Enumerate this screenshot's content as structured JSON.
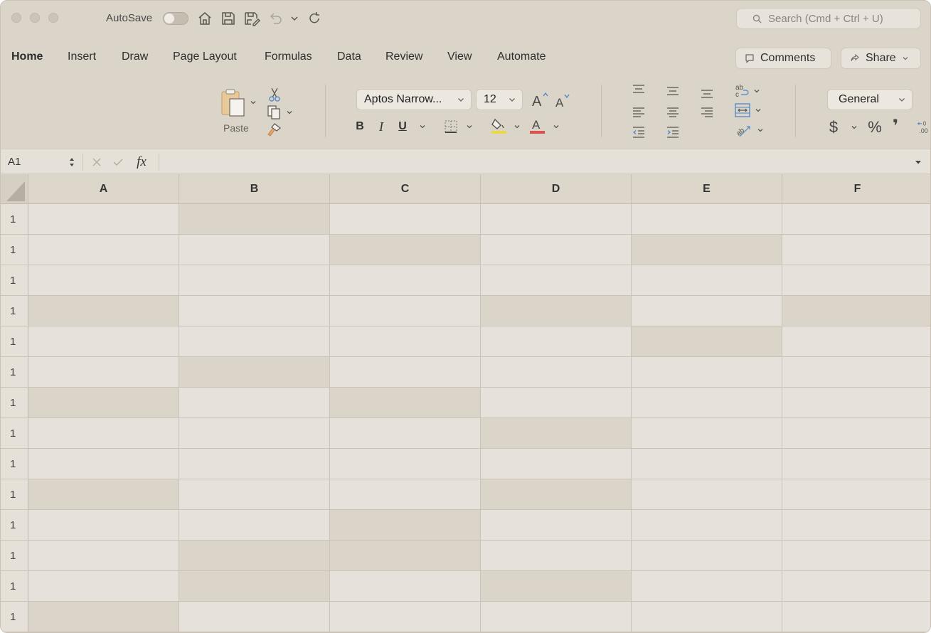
{
  "titlebar": {
    "autosave_label": "AutoSave",
    "search_placeholder": "Search (Cmd + Ctrl + U)"
  },
  "menu": {
    "tabs": [
      "Home",
      "Insert",
      "Draw",
      "Page Layout",
      "Formulas",
      "Data",
      "Review",
      "View",
      "Automate"
    ],
    "active_tab": "Home",
    "comments_label": "Comments",
    "share_label": "Share"
  },
  "ribbon": {
    "paste_label": "Paste",
    "font_name": "Aptos Narrow...",
    "font_size": "12",
    "bold": "B",
    "italic": "I",
    "underline": "U",
    "font_color_glyph": "A",
    "number_format": "General",
    "currency_glyph": "$",
    "percent_glyph": "%",
    "comma_glyph": "❜",
    "highlight_color": "#e8d84a",
    "font_color": "#d9534f"
  },
  "formula_bar": {
    "name_box": "A1",
    "fx_label": "fx",
    "formula": ""
  },
  "sheet": {
    "columns": [
      "A",
      "B",
      "C",
      "D",
      "E",
      "F"
    ],
    "row_labels": [
      "1",
      "1",
      "1",
      "1",
      "1",
      "1",
      "1",
      "1",
      "1",
      "1",
      "1",
      "1",
      "1",
      "1"
    ],
    "shaded_cells": [
      [
        1
      ],
      [
        2,
        4
      ],
      [],
      [
        0,
        3,
        5
      ],
      [
        4
      ],
      [
        1
      ],
      [
        0,
        2
      ],
      [
        3
      ],
      [],
      [
        0,
        3
      ],
      [
        2
      ],
      [
        1,
        2
      ],
      [
        1,
        3
      ],
      [
        0
      ]
    ],
    "colors": {
      "cell": "#e6e1da",
      "shaded_cell": "#dbd5c9"
    }
  }
}
